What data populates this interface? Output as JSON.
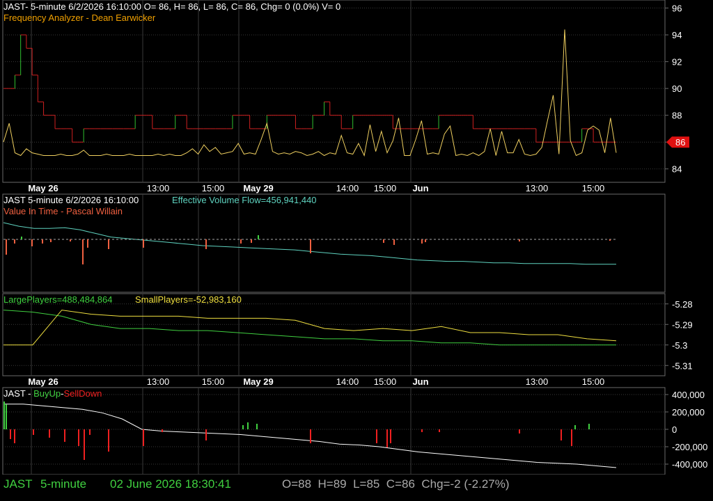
{
  "colors": {
    "background": "#000000",
    "grid": "#3a3a3a",
    "separator": "#6a6a6a",
    "title_white": "#ffffff",
    "analyzer_orange": "#f0a000",
    "cyan": "#5fd3c0",
    "salmon": "#f06040",
    "green": "#40d040",
    "yellow": "#f0e040",
    "red": "#f02020",
    "price_red": "#d02020",
    "price_green": "#30c030",
    "price_yellow": "#f0d060",
    "flag_red": "#e01010"
  },
  "pane1": {
    "title": "JAST- 5-minute 6/2/2026 16:10:00 O= 86, H= 86, L= 86, C= 86, Chg= 0 (0.0%) V= 0",
    "subtitle": "Frequency Analyzer - Dean Earwicker",
    "last_price": "86"
  },
  "pane2": {
    "title": "JAST 5-minute  6/2/2026 16:10:00",
    "evf_label": "Effective Volume Flow=456,941,440",
    "subtitle": "Value In Time - Pascal Willain"
  },
  "pane3": {
    "large_label": "LargePlayers=488,484,864",
    "small_label": "SmallPlayers=-52,983,160"
  },
  "pane4": {
    "prefix": "JAST - ",
    "buyup": "BuyUp",
    "dash": "-",
    "selldown": "SellDown"
  },
  "time_axis": {
    "labels": [
      {
        "text": "May 26",
        "bold": true
      },
      {
        "text": "13:00",
        "bold": false
      },
      {
        "text": "15:00",
        "bold": false
      },
      {
        "text": "May 29",
        "bold": true
      },
      {
        "text": "14:00",
        "bold": false
      },
      {
        "text": "15:00",
        "bold": false
      },
      {
        "text": "Jun",
        "bold": true
      },
      {
        "text": "13:00",
        "bold": false
      },
      {
        "text": "15:00",
        "bold": false
      }
    ]
  },
  "status_bar": {
    "symbol": "JAST",
    "interval": "5-minute",
    "datetime": "02 June 2026 18:30:41",
    "ohlc": "O=88  H=89  L=85  C=86  Chg=-2 (-2.27%)"
  },
  "chart_data": [
    {
      "type": "line",
      "name": "price pane",
      "title": "JAST- 5-minute 6/2/2026 16:10:00 O= 86, H= 86, L= 86, C= 86, Chg= 0 (0.0%) V= 0",
      "ylim": [
        83,
        96.6
      ],
      "yticks": [
        "84",
        "86",
        "88",
        "90",
        "92",
        "94",
        "96"
      ],
      "last_value": 86,
      "series": [
        {
          "name": "Frequency Analyzer",
          "values": [
            86,
            87.4,
            85.2,
            85,
            85.5,
            85.2,
            85.1,
            85,
            85,
            85,
            85.1,
            85,
            85,
            85.1,
            85.4,
            85,
            85,
            85,
            85.1,
            85,
            85,
            85,
            85.1,
            85,
            85,
            85,
            85,
            85.1,
            85,
            85.1,
            85,
            85,
            85.2,
            85.5,
            85.1,
            85.8,
            85.3,
            85.6,
            85.1,
            85.2,
            85.3,
            85.9,
            85.1,
            85.2,
            85.1,
            86.2,
            87.4,
            85.3,
            85.1,
            85.2,
            85.1,
            85.3,
            85.2,
            85,
            85.1,
            85.3,
            85,
            85.2,
            85.1,
            86.5,
            85.2,
            85.1,
            85.9,
            85,
            87.3,
            85.3,
            86.8,
            85.2,
            86.1,
            87.8,
            85,
            85,
            86.2,
            87.6,
            85.1,
            85.2,
            85.1,
            86.6,
            87.2,
            85,
            85.1,
            85,
            85.2,
            85,
            85.3,
            87,
            85,
            86.8,
            85.2,
            85.2,
            86.2,
            85.1,
            85,
            85.1,
            85.6,
            87.6,
            89.5,
            85.1,
            94.4,
            86.1,
            85,
            85.2,
            86.9,
            87.2,
            86.9,
            85.2,
            87.8,
            85.2
          ]
        }
      ]
    },
    {
      "type": "bar",
      "name": "Value In Time pane",
      "title": "Effective Volume Flow=456,941,440",
      "series": [
        {
          "name": "Effective Volume Flow",
          "values": [
            100,
            95,
            92,
            92,
            93,
            90,
            85,
            80,
            78,
            76,
            74,
            72,
            70,
            68,
            67,
            66,
            65,
            64,
            63,
            62,
            60,
            58,
            56,
            55,
            54,
            52,
            50,
            48,
            47,
            46,
            46,
            45,
            44,
            44,
            43,
            43,
            43,
            43,
            42,
            42,
            42
          ]
        }
      ]
    },
    {
      "type": "line",
      "name": "players pane",
      "ylim": [
        -5.315,
        -5.275
      ],
      "yticks": [
        "-5.28",
        "-5.29",
        "-5.3",
        "-5.31"
      ],
      "series": [
        {
          "name": "LargePlayers",
          "values": [
            -5.283,
            -5.284,
            -5.286,
            -5.29,
            -5.292,
            -5.292,
            -5.293,
            -5.293,
            -5.294,
            -5.295,
            -5.296,
            -5.297,
            -5.297,
            -5.298,
            -5.298,
            -5.299,
            -5.299,
            -5.3,
            -5.3,
            -5.3,
            -5.3,
            -5.3
          ]
        },
        {
          "name": "SmallPlayers",
          "values": [
            -5.3,
            -5.3,
            -5.283,
            -5.285,
            -5.286,
            -5.286,
            -5.286,
            -5.287,
            -5.287,
            -5.287,
            -5.288,
            -5.292,
            -5.293,
            -5.292,
            -5.293,
            -5.291,
            -5.294,
            -5.294,
            -5.295,
            -5.295,
            -5.297,
            -5.298
          ]
        }
      ]
    },
    {
      "type": "bar",
      "name": "BuyUp-SellDown pane",
      "ylim": [
        -520000,
        480000
      ],
      "yticks": [
        "400,000",
        "200,000",
        "0",
        "-200,000",
        "-400,000"
      ],
      "series": [
        {
          "name": "cumulative",
          "values": [
            290000,
            290000,
            270000,
            250000,
            230000,
            190000,
            120000,
            0,
            -20000,
            -30000,
            -40000,
            -50000,
            -60000,
            -80000,
            -100000,
            -120000,
            -140000,
            -170000,
            -180000,
            -200000,
            -230000,
            -260000,
            -280000,
            -300000,
            -320000,
            -340000,
            -360000,
            -380000,
            -390000,
            -400000,
            -420000,
            -440000
          ]
        }
      ]
    }
  ]
}
